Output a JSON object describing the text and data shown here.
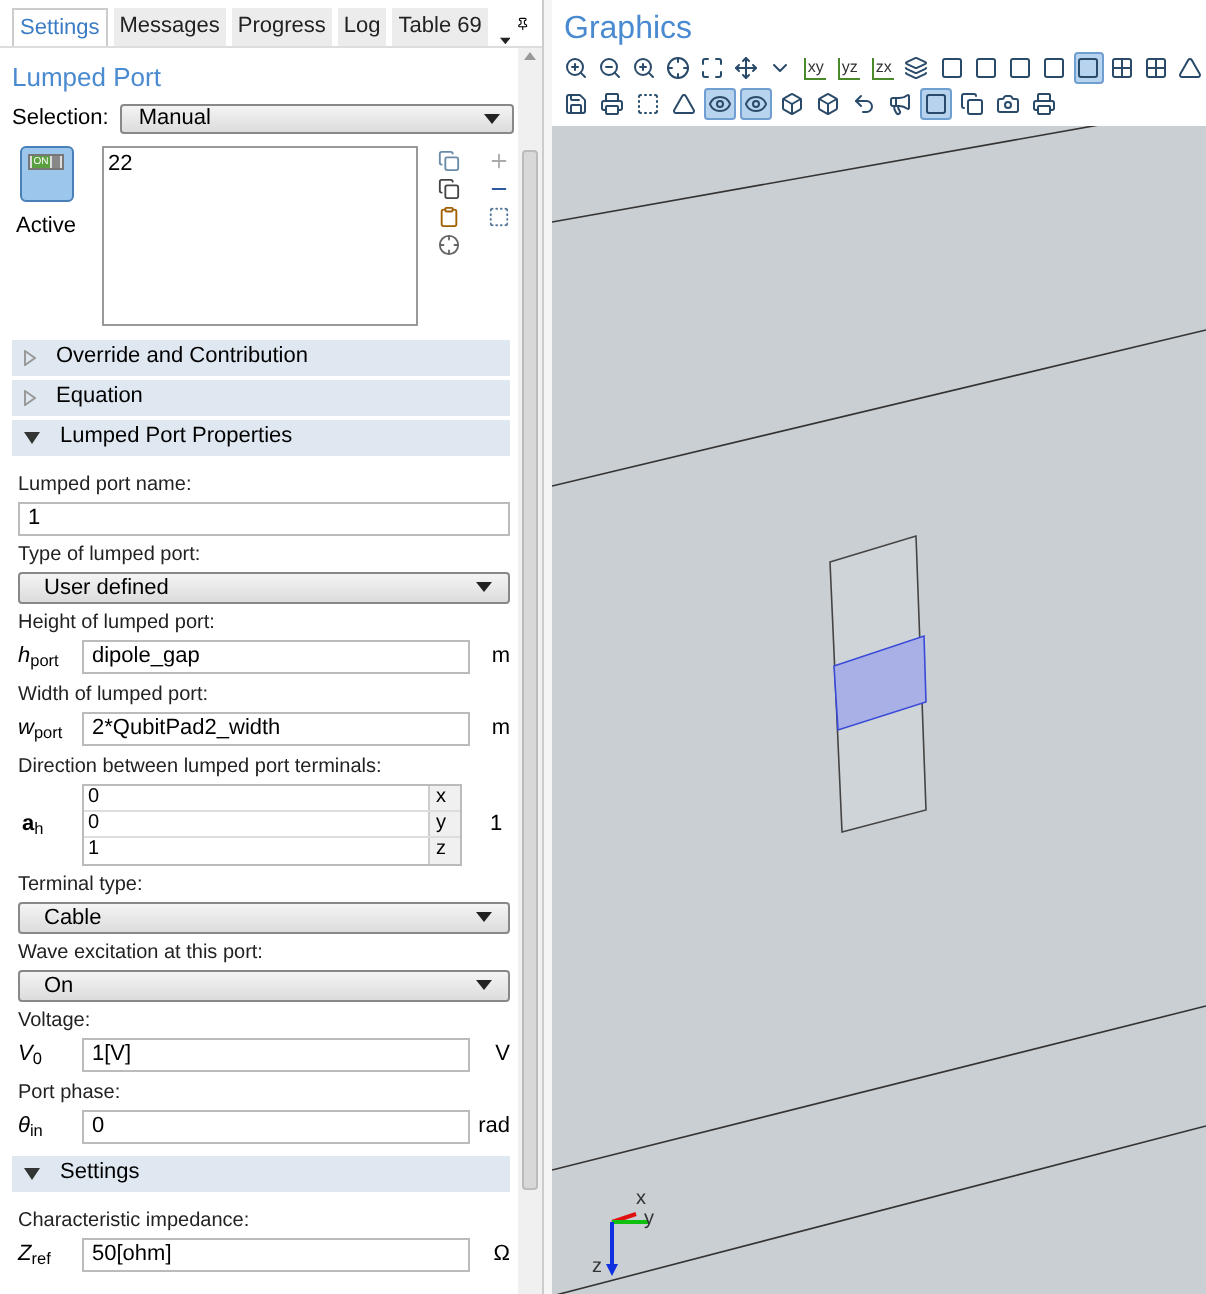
{
  "tabs": [
    {
      "label": "Settings",
      "selected": true
    },
    {
      "label": "Messages",
      "selected": false
    },
    {
      "label": "Progress",
      "selected": false
    },
    {
      "label": "Log",
      "selected": false
    },
    {
      "label": "Table 69",
      "selected": false
    }
  ],
  "panel_title": "Lumped Port",
  "selection": {
    "label": "Selection:",
    "value": "Manual"
  },
  "active": {
    "label": "Active",
    "switch_text": "ON",
    "on": true
  },
  "selection_list": [
    "22"
  ],
  "sections": [
    {
      "title": "Override and Contribution",
      "expanded": false
    },
    {
      "title": "Equation",
      "expanded": false
    },
    {
      "title": "Lumped Port Properties",
      "expanded": true,
      "fields": [
        {
          "kind": "text",
          "label": "Lumped port name:",
          "value": "1"
        },
        {
          "kind": "select",
          "label": "Type of lumped port:",
          "value": "User defined"
        },
        {
          "kind": "quantity",
          "label": "Height of lumped port:",
          "symbol": "*h*$_{port}$",
          "value": "dipole_gap",
          "unit": "m"
        },
        {
          "kind": "quantity",
          "label": "Width of lumped port:",
          "symbol": "*w*$_{port}$",
          "value": "2*QubitPad2_width",
          "unit": "m"
        },
        {
          "kind": "vector",
          "label": "Direction between lumped port terminals:",
          "symbol": "**a**$_{h}$",
          "rows": [
            {
              "value": "0",
              "component": "x"
            },
            {
              "value": "0",
              "component": "y"
            },
            {
              "value": "1",
              "component": "z"
            }
          ],
          "unit": "1"
        },
        {
          "kind": "select",
          "label": "Terminal type:",
          "value": "Cable"
        },
        {
          "kind": "select",
          "label": "Wave excitation at this port:",
          "value": "On"
        },
        {
          "kind": "quantity",
          "label": "Voltage:",
          "symbol": "*V*$_{0}$",
          "value": "1[V]",
          "unit": "V"
        },
        {
          "kind": "quantity",
          "label": "Port phase:",
          "symbol": "*θ*$_{in}$",
          "value": "0",
          "unit": "rad"
        }
      ]
    },
    {
      "title": "Settings",
      "expanded": true,
      "fields": [
        {
          "kind": "quantity",
          "label": "Characteristic impedance:",
          "symbol": "*Z*$_{ref}$",
          "value": "50[ohm]",
          "unit": "Ω"
        }
      ]
    }
  ],
  "graphics": {
    "title": "Graphics",
    "toolbar_row_1": [
      {
        "selected": false
      },
      {
        "selected": false
      },
      {
        "selected": false
      },
      {
        "selected": false
      },
      {
        "selected": false
      },
      {
        "selected": false
      },
      {
        "selected": false
      },
      {
        "selected": false
      },
      {
        "selected": false
      },
      {
        "selected": false
      },
      {
        "selected": false
      },
      {
        "selected": false
      },
      {
        "selected": true
      },
      {
        "selected": false
      },
      {
        "selected": false
      },
      {
        "selected": false
      }
    ],
    "plane_views": [
      "xy",
      "yz",
      "zx"
    ],
    "toolbar_row_2": [
      {
        "selected": false
      },
      {
        "selected": false
      },
      {
        "selected": false
      },
      {
        "selected": false
      },
      {
        "selected": true
      },
      {
        "selected": true
      },
      {
        "selected": false
      },
      {
        "selected": false
      },
      {
        "selected": false
      },
      {
        "selected": false
      },
      {
        "selected": true
      },
      {
        "selected": false
      },
      {
        "selected": false
      },
      {
        "selected": false
      }
    ],
    "axes": [
      "x",
      "y",
      "z"
    ]
  }
}
